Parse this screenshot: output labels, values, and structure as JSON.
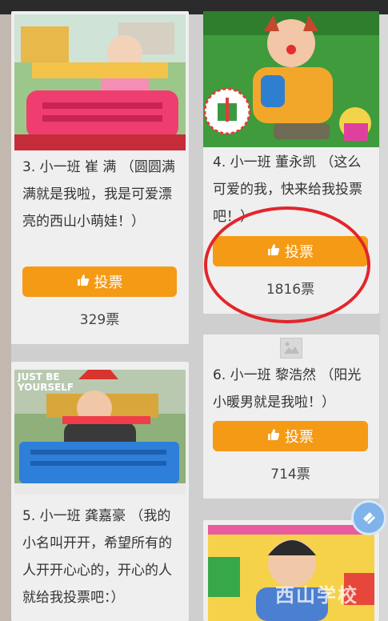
{
  "cards": [
    {
      "text": "3. 小一班 崔 满 （圆圆满满就是我啦，我是可爱漂亮的西山小萌娃！）",
      "vote_label": "投票",
      "count": "329票"
    },
    {
      "text": "4. 小一班 董永凯 （这么可爱的我，快来给我投票吧！）",
      "vote_label": "投票",
      "count": "1816票"
    },
    {
      "text": "6. 小一班 黎浩然 （阳光小暖男就是我啦！）",
      "vote_label": "投票",
      "count": "714票"
    },
    {
      "text": "5. 小一班 龚嘉豪 （我的小名叫开开，希望所有的人开开心心的，开心的人就给我投票吧：）"
    }
  ],
  "photo_overlay": {
    "line1": "JUST BE",
    "line2": "YOURSELF"
  },
  "watermark": "西山学校",
  "icons": {
    "thumb": "thumbs-up-icon",
    "placeholder": "image-placeholder-icon"
  },
  "colors": {
    "accent": "#f59a14",
    "annotation": "#e3252b"
  }
}
